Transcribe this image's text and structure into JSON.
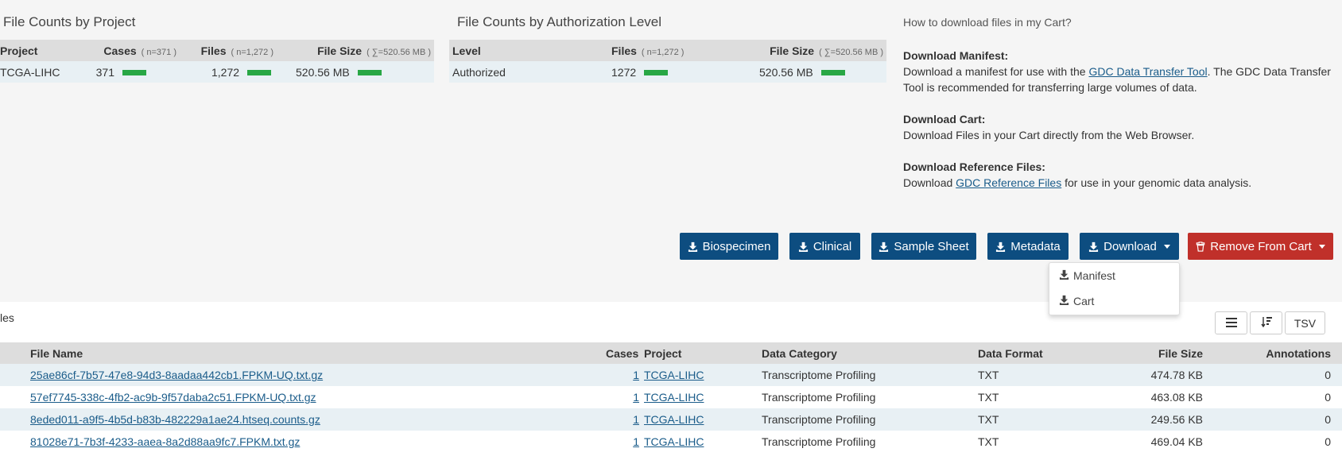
{
  "project_panel": {
    "title": "File Counts by Project",
    "headers": {
      "project": "Project",
      "cases": "Cases",
      "cases_n": "( n=371 )",
      "files": "Files",
      "files_n": "( n=1,272 )",
      "size": "File Size",
      "size_n": "( ∑=520.56 MB )"
    },
    "row": {
      "project": "TCGA-LIHC",
      "cases": "371",
      "files": "1,272",
      "size": "520.56 MB"
    }
  },
  "auth_panel": {
    "title": "File Counts by Authorization Level",
    "headers": {
      "level": "Level",
      "files": "Files",
      "files_n": "( n=1,272 )",
      "size": "File Size",
      "size_n": "( ∑=520.56 MB )"
    },
    "row": {
      "level": "Authorized",
      "files": "1272",
      "size": "520.56 MB"
    }
  },
  "help": {
    "question": "How to download files in my Cart?",
    "manifest_title": "Download Manifest:",
    "manifest_text_1": "Download a manifest for use with the ",
    "manifest_link": "GDC Data Transfer Tool",
    "manifest_text_2": ". The GDC Data Transfer Tool is recommended for transferring large volumes of data.",
    "cart_title": "Download Cart:",
    "cart_text": "Download Files in your Cart directly from the Web Browser.",
    "ref_title": "Download Reference Files:",
    "ref_text_1": "Download ",
    "ref_link": "GDC Reference Files",
    "ref_text_2": " for use in your genomic data analysis."
  },
  "actions": {
    "biospecimen": "Biospecimen",
    "clinical": "Clinical",
    "sample_sheet": "Sample Sheet",
    "metadata": "Metadata",
    "download": "Download",
    "remove": "Remove From Cart"
  },
  "download_menu": {
    "manifest": "Manifest",
    "cart": "Cart"
  },
  "files_panel": {
    "title": "les",
    "tsv": "TSV",
    "headers": {
      "file_name": "File Name",
      "cases": "Cases",
      "project": "Project",
      "data_category": "Data Category",
      "data_format": "Data Format",
      "file_size": "File Size",
      "annotations": "Annotations"
    },
    "rows": [
      {
        "file_name": "25ae86cf-7b57-47e8-94d3-8aadaa442cb1.FPKM-UQ.txt.gz",
        "cases": "1",
        "project": "TCGA-LIHC",
        "data_category": "Transcriptome Profiling",
        "data_format": "TXT",
        "file_size": "474.78 KB",
        "annotations": "0"
      },
      {
        "file_name": "57ef7745-338c-4fb2-ac9b-9f57daba2c51.FPKM-UQ.txt.gz",
        "cases": "1",
        "project": "TCGA-LIHC",
        "data_category": "Transcriptome Profiling",
        "data_format": "TXT",
        "file_size": "463.08 KB",
        "annotations": "0"
      },
      {
        "file_name": "8eded011-a9f5-4b5d-b83b-482229a1ae24.htseq.counts.gz",
        "cases": "1",
        "project": "TCGA-LIHC",
        "data_category": "Transcriptome Profiling",
        "data_format": "TXT",
        "file_size": "249.56 KB",
        "annotations": "0"
      },
      {
        "file_name": "81028e71-7b3f-4233-aaea-8a2d88aa9fc7.FPKM.txt.gz",
        "cases": "1",
        "project": "TCGA-LIHC",
        "data_category": "Transcriptome Profiling",
        "data_format": "TXT",
        "file_size": "469.04 KB",
        "annotations": "0"
      }
    ]
  },
  "colors": {
    "primary": "#0d4d80",
    "danger": "#c0302a",
    "bar": "#28a745",
    "row_alt": "#e8f0f4"
  }
}
